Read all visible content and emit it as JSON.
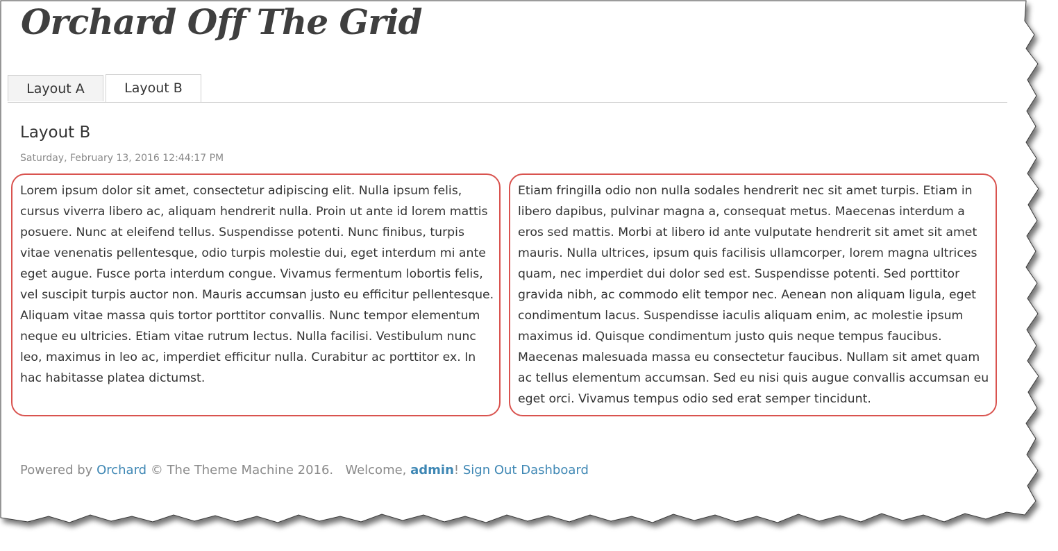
{
  "site": {
    "title": "Orchard Off The Grid"
  },
  "tabs": [
    {
      "label": "Layout A",
      "active": false
    },
    {
      "label": "Layout B",
      "active": true
    }
  ],
  "content": {
    "heading": "Layout B",
    "timestamp": "Saturday, February 13, 2016 12:44:17 PM",
    "column1": "Lorem ipsum dolor sit amet, consectetur adipiscing elit. Nulla ipsum felis, cursus viverra libero ac, aliquam hendrerit nulla. Proin ut ante id lorem mattis posuere. Nunc at eleifend tellus. Suspendisse potenti. Nunc finibus, turpis vitae venenatis pellentesque, odio turpis molestie dui, eget interdum mi ante eget augue. Fusce porta interdum congue. Vivamus fermentum lobortis felis, vel suscipit turpis auctor non. Mauris accumsan justo eu efficitur pellentesque. Aliquam vitae massa quis tortor porttitor convallis. Nunc tempor elementum neque eu ultricies. Etiam vitae rutrum lectus. Nulla facilisi. Vestibulum nunc leo, maximus in leo ac, imperdiet efficitur nulla. Curabitur ac porttitor ex. In hac habitasse platea dictumst.",
    "column2": "Etiam fringilla odio non nulla sodales hendrerit nec sit amet turpis. Etiam in libero dapibus, pulvinar magna a, consequat metus. Maecenas interdum a eros sed mattis. Morbi at libero id ante vulputate hendrerit sit amet sit amet mauris. Nulla ultrices, ipsum quis facilisis ullamcorper, lorem magna ultrices quam, nec imperdiet dui dolor sed est. Suspendisse potenti. Sed porttitor gravida nibh, ac commodo elit tempor nec. Aenean non aliquam ligula, eget condimentum lacus. Suspendisse iaculis aliquam enim, ac molestie ipsum maximus id. Quisque condimentum justo quis neque tempus faucibus. Maecenas malesuada massa eu consectetur faucibus. Nullam sit amet quam ac tellus elementum accumsan. Sed eu nisi quis augue convallis accumsan eu eget orci. Vivamus tempus odio sed erat semper tincidunt."
  },
  "footer": {
    "powered_by": "Powered by",
    "orchard_link": "Orchard",
    "copyright": "© The Theme Machine 2016.",
    "welcome": "Welcome,",
    "username": "admin",
    "exclaim": "!",
    "sign_out": "Sign Out",
    "dashboard": "Dashboard"
  },
  "colors": {
    "accent_border": "#d9534f",
    "link": "#3e87b4",
    "muted_text": "#8a8a8a"
  }
}
